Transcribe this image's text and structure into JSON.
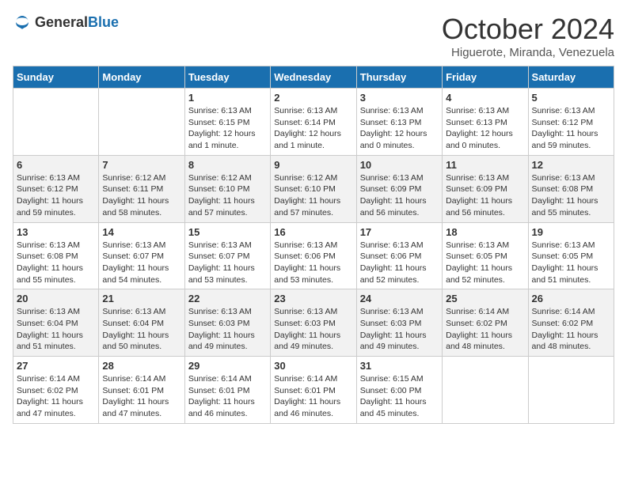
{
  "header": {
    "logo_general": "General",
    "logo_blue": "Blue",
    "month": "October 2024",
    "location": "Higuerote, Miranda, Venezuela"
  },
  "weekdays": [
    "Sunday",
    "Monday",
    "Tuesday",
    "Wednesday",
    "Thursday",
    "Friday",
    "Saturday"
  ],
  "weeks": [
    [
      null,
      null,
      {
        "day": 1,
        "sunrise": "6:13 AM",
        "sunset": "6:15 PM",
        "daylight": "12 hours and 1 minute."
      },
      {
        "day": 2,
        "sunrise": "6:13 AM",
        "sunset": "6:14 PM",
        "daylight": "12 hours and 1 minute."
      },
      {
        "day": 3,
        "sunrise": "6:13 AM",
        "sunset": "6:13 PM",
        "daylight": "12 hours and 0 minutes."
      },
      {
        "day": 4,
        "sunrise": "6:13 AM",
        "sunset": "6:13 PM",
        "daylight": "12 hours and 0 minutes."
      },
      {
        "day": 5,
        "sunrise": "6:13 AM",
        "sunset": "6:12 PM",
        "daylight": "11 hours and 59 minutes."
      }
    ],
    [
      {
        "day": 6,
        "sunrise": "6:13 AM",
        "sunset": "6:12 PM",
        "daylight": "11 hours and 59 minutes."
      },
      {
        "day": 7,
        "sunrise": "6:12 AM",
        "sunset": "6:11 PM",
        "daylight": "11 hours and 58 minutes."
      },
      {
        "day": 8,
        "sunrise": "6:12 AM",
        "sunset": "6:10 PM",
        "daylight": "11 hours and 57 minutes."
      },
      {
        "day": 9,
        "sunrise": "6:12 AM",
        "sunset": "6:10 PM",
        "daylight": "11 hours and 57 minutes."
      },
      {
        "day": 10,
        "sunrise": "6:13 AM",
        "sunset": "6:09 PM",
        "daylight": "11 hours and 56 minutes."
      },
      {
        "day": 11,
        "sunrise": "6:13 AM",
        "sunset": "6:09 PM",
        "daylight": "11 hours and 56 minutes."
      },
      {
        "day": 12,
        "sunrise": "6:13 AM",
        "sunset": "6:08 PM",
        "daylight": "11 hours and 55 minutes."
      }
    ],
    [
      {
        "day": 13,
        "sunrise": "6:13 AM",
        "sunset": "6:08 PM",
        "daylight": "11 hours and 55 minutes."
      },
      {
        "day": 14,
        "sunrise": "6:13 AM",
        "sunset": "6:07 PM",
        "daylight": "11 hours and 54 minutes."
      },
      {
        "day": 15,
        "sunrise": "6:13 AM",
        "sunset": "6:07 PM",
        "daylight": "11 hours and 53 minutes."
      },
      {
        "day": 16,
        "sunrise": "6:13 AM",
        "sunset": "6:06 PM",
        "daylight": "11 hours and 53 minutes."
      },
      {
        "day": 17,
        "sunrise": "6:13 AM",
        "sunset": "6:06 PM",
        "daylight": "11 hours and 52 minutes."
      },
      {
        "day": 18,
        "sunrise": "6:13 AM",
        "sunset": "6:05 PM",
        "daylight": "11 hours and 52 minutes."
      },
      {
        "day": 19,
        "sunrise": "6:13 AM",
        "sunset": "6:05 PM",
        "daylight": "11 hours and 51 minutes."
      }
    ],
    [
      {
        "day": 20,
        "sunrise": "6:13 AM",
        "sunset": "6:04 PM",
        "daylight": "11 hours and 51 minutes."
      },
      {
        "day": 21,
        "sunrise": "6:13 AM",
        "sunset": "6:04 PM",
        "daylight": "11 hours and 50 minutes."
      },
      {
        "day": 22,
        "sunrise": "6:13 AM",
        "sunset": "6:03 PM",
        "daylight": "11 hours and 49 minutes."
      },
      {
        "day": 23,
        "sunrise": "6:13 AM",
        "sunset": "6:03 PM",
        "daylight": "11 hours and 49 minutes."
      },
      {
        "day": 24,
        "sunrise": "6:13 AM",
        "sunset": "6:03 PM",
        "daylight": "11 hours and 49 minutes."
      },
      {
        "day": 25,
        "sunrise": "6:14 AM",
        "sunset": "6:02 PM",
        "daylight": "11 hours and 48 minutes."
      },
      {
        "day": 26,
        "sunrise": "6:14 AM",
        "sunset": "6:02 PM",
        "daylight": "11 hours and 48 minutes."
      }
    ],
    [
      {
        "day": 27,
        "sunrise": "6:14 AM",
        "sunset": "6:02 PM",
        "daylight": "11 hours and 47 minutes."
      },
      {
        "day": 28,
        "sunrise": "6:14 AM",
        "sunset": "6:01 PM",
        "daylight": "11 hours and 47 minutes."
      },
      {
        "day": 29,
        "sunrise": "6:14 AM",
        "sunset": "6:01 PM",
        "daylight": "11 hours and 46 minutes."
      },
      {
        "day": 30,
        "sunrise": "6:14 AM",
        "sunset": "6:01 PM",
        "daylight": "11 hours and 46 minutes."
      },
      {
        "day": 31,
        "sunrise": "6:15 AM",
        "sunset": "6:00 PM",
        "daylight": "11 hours and 45 minutes."
      },
      null,
      null
    ]
  ],
  "labels": {
    "sunrise": "Sunrise:",
    "sunset": "Sunset:",
    "daylight": "Daylight:"
  }
}
